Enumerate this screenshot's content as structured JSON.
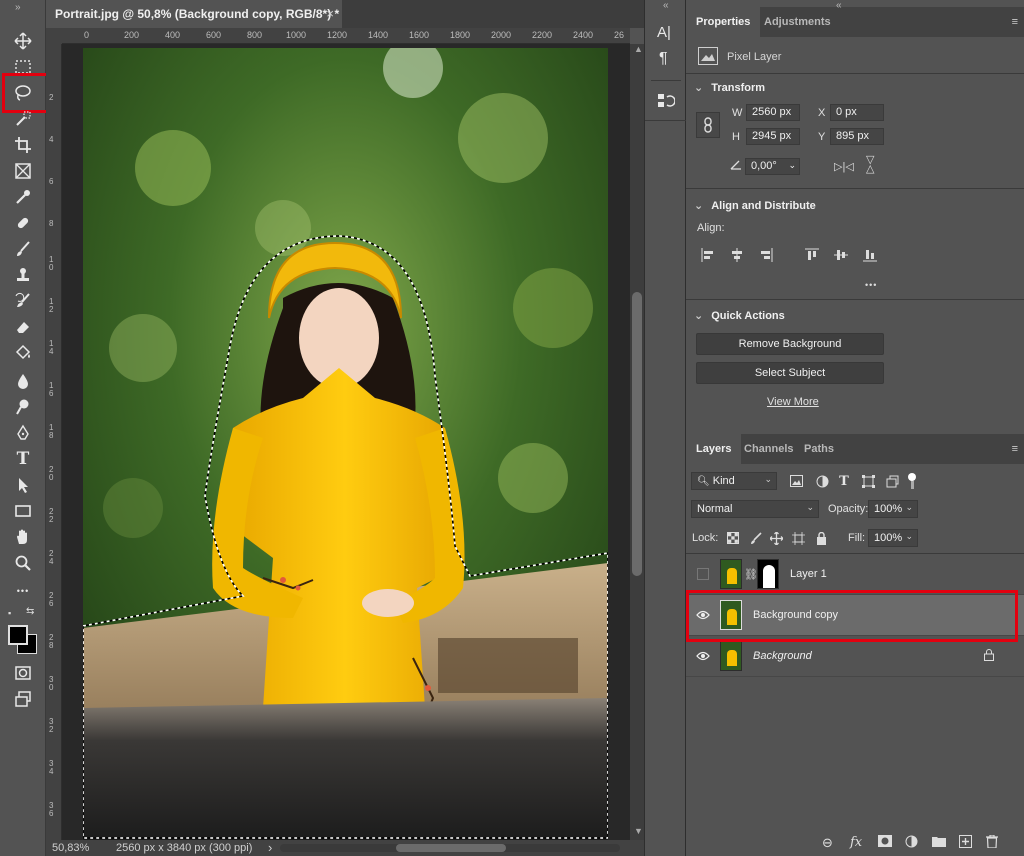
{
  "document_tab": {
    "title": "Portrait.jpg @ 50,8% (Background copy, RGB/8*) *",
    "close": "×"
  },
  "ruler": {
    "top_ticks": [
      "0",
      "200",
      "400",
      "600",
      "800",
      "1000",
      "1200",
      "1400",
      "1600",
      "1800",
      "2000",
      "2200",
      "2400",
      "26"
    ],
    "left_ticks": [
      "2",
      "4",
      "6",
      "8",
      "1 0",
      "1 2",
      "1 4",
      "1 6",
      "1 8",
      "2 0",
      "2 2",
      "2 4",
      "2 6",
      "2 8",
      "3 0",
      "3 2",
      "3 4",
      "3 6"
    ]
  },
  "status_bar": {
    "zoom": "50,83%",
    "doc_info": "2560 px x 3840 px (300 ppi)",
    "arrow": "›"
  },
  "toolbar": {
    "collapse": "»",
    "tools": [
      "move-tool",
      "marquee-tool",
      "lasso-tool",
      "object-selection-tool",
      "crop-tool",
      "frame-tool",
      "eyedropper-tool",
      "healing-brush-tool",
      "brush-tool",
      "clone-stamp-tool",
      "history-brush-tool",
      "eraser-tool",
      "paint-bucket-tool",
      "blur-tool",
      "dodge-tool",
      "pen-tool",
      "type-tool",
      "path-selection-tool",
      "rectangle-tool",
      "hand-tool",
      "zoom-tool",
      "more-tools"
    ],
    "type_glyph": "T",
    "more_glyph": "•••"
  },
  "mid_strip": {
    "collapse": "«",
    "char_glyph": "A|",
    "para_glyph": "¶"
  },
  "properties": {
    "tabs": [
      "Properties",
      "Adjustments"
    ],
    "collapse": "«",
    "layer_type": "Pixel Layer",
    "transform": {
      "title": "Transform",
      "w_label": "W",
      "w_value": "2560 px",
      "h_label": "H",
      "h_value": "2945 px",
      "x_label": "X",
      "x_value": "0 px",
      "y_label": "Y",
      "y_value": "895 px",
      "angle_value": "0,00°"
    },
    "align": {
      "title": "Align and Distribute",
      "label": "Align:",
      "more": "•••"
    },
    "quick_actions": {
      "title": "Quick Actions",
      "remove_bg": "Remove Background",
      "select_subject": "Select Subject",
      "view_more": "View More"
    }
  },
  "layers_panel": {
    "tabs": [
      "Layers",
      "Channels",
      "Paths"
    ],
    "filter_kind": "Kind",
    "blend_mode": "Normal",
    "opacity_label": "Opacity:",
    "opacity_value": "100%",
    "lock_label": "Lock:",
    "fill_label": "Fill:",
    "fill_value": "100%",
    "layers": [
      {
        "name": "Layer 1",
        "visible": false
      },
      {
        "name": "Background copy",
        "visible": true,
        "selected": true
      },
      {
        "name": "Background",
        "visible": true,
        "locked": true
      }
    ],
    "footer": {
      "link": "⊖",
      "fx": "fx"
    }
  },
  "colors": {
    "highlight_red": "#e3000f",
    "panel_bg": "#535353",
    "dress_yellow": "#f5c000"
  }
}
